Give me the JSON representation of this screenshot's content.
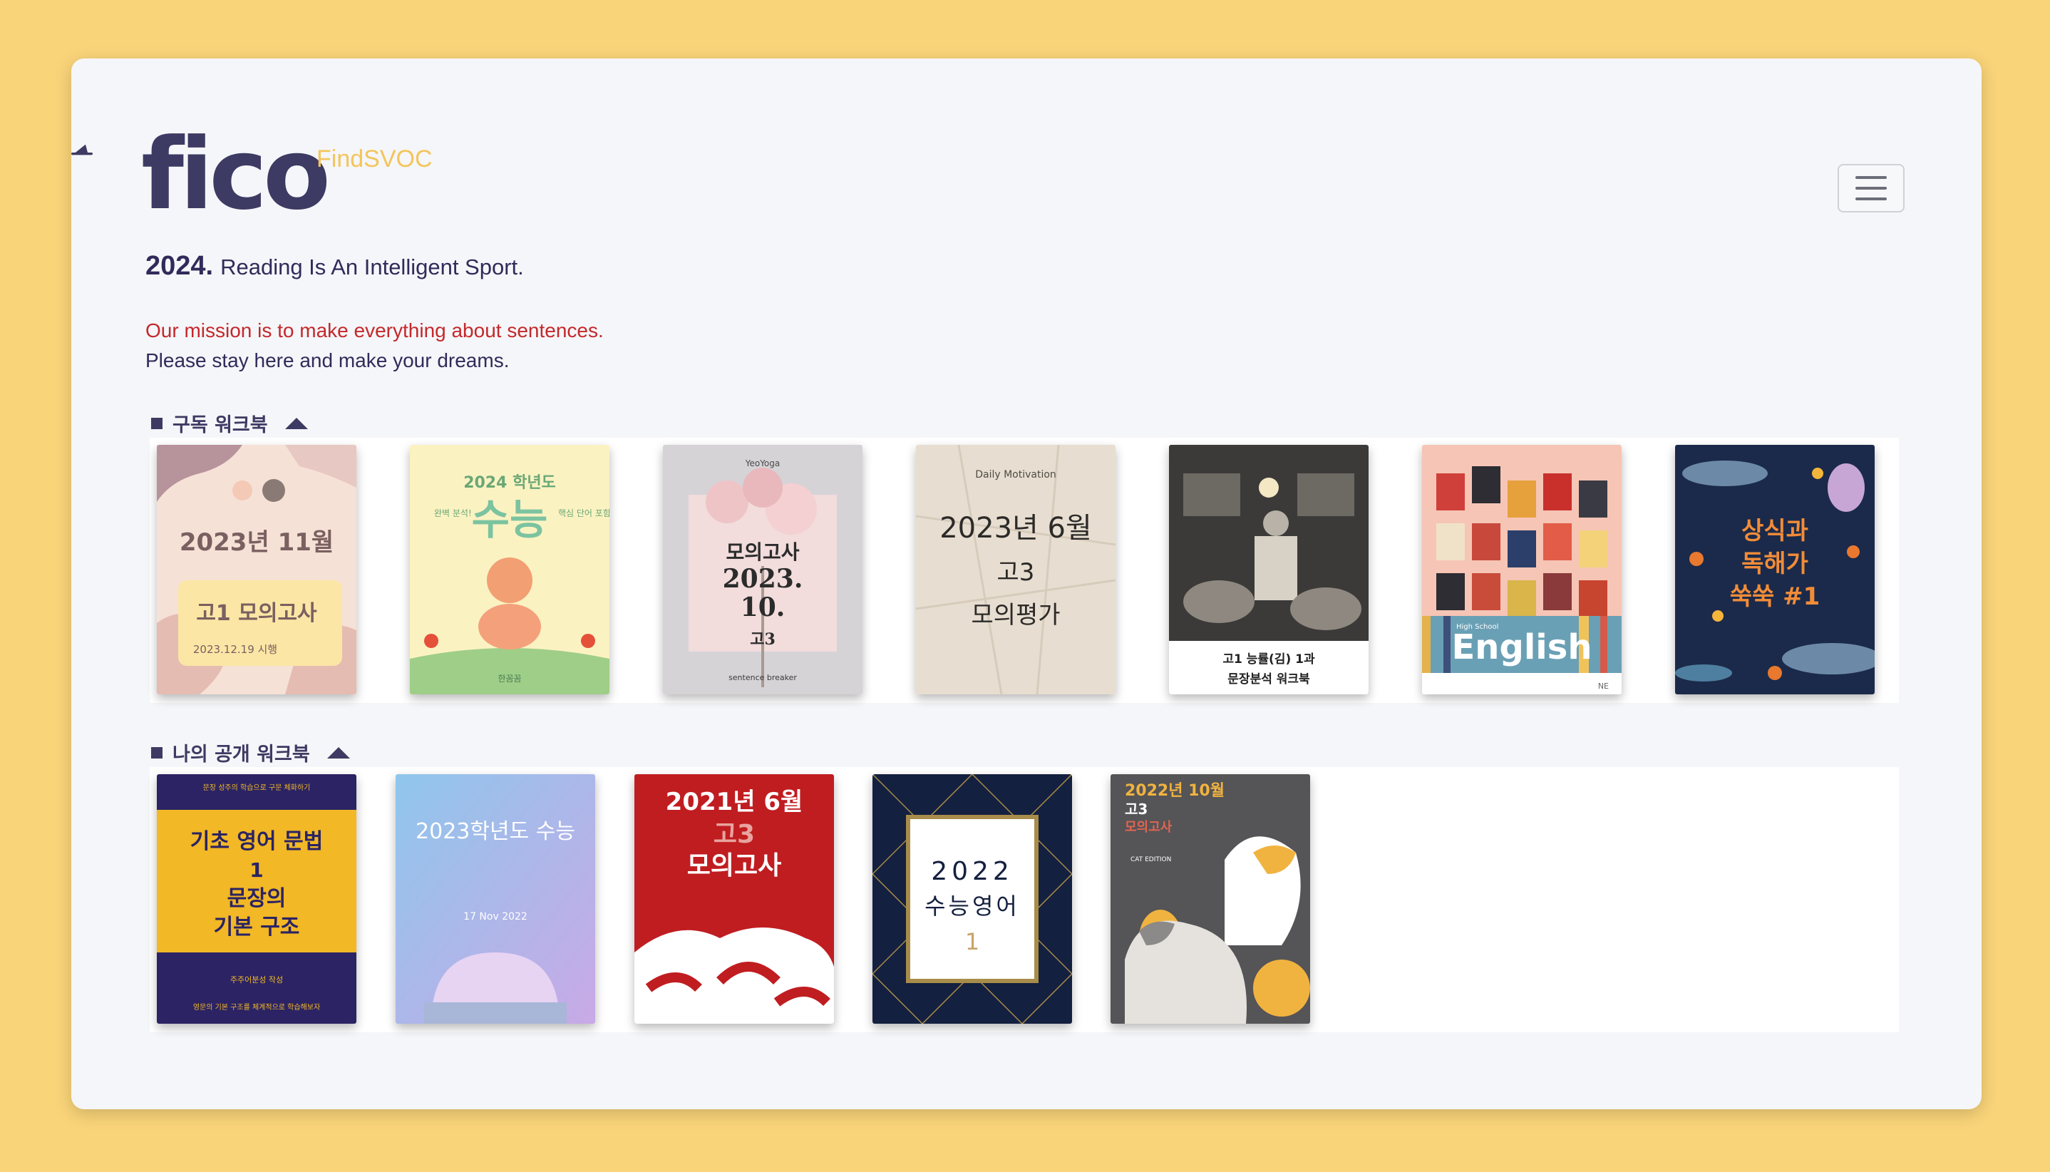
{
  "header": {
    "logo_main": "fico",
    "logo_sub": "FindSVOC",
    "menu_icon": "hamburger-menu-icon"
  },
  "tagline": {
    "year": "2024.",
    "text": "Reading Is An Intelligent Sport."
  },
  "mission": {
    "line1": "Our mission is to make everything about sentences.",
    "line2": "Please stay here and make your dreams."
  },
  "sections": {
    "subscribed": {
      "title": "구독 워크북",
      "books": [
        {
          "title_main": "2023년 11월",
          "title_sub": "고1 모의고사",
          "date": "2023.12.19 시행"
        },
        {
          "title_top": "2024 학년도",
          "title_main": "수능",
          "left_note": "완벽 분석!",
          "right_note": "핵심 단어 포함!",
          "footer": "한꼼꼼"
        },
        {
          "brand": "YeoYoga",
          "title_main": "모의고사",
          "line2": "2023.",
          "line3": "10.",
          "line4": "고3",
          "footer": "sentence breaker"
        },
        {
          "top": "Daily Motivation",
          "line1": "2023년 6월",
          "line2": "고3",
          "line3": "모의평가"
        },
        {
          "line1": "고1 능률(김) 1과",
          "line2": "문장분석 워크북"
        },
        {
          "small": "High School",
          "title_main": "English",
          "corner": "NE"
        },
        {
          "line1": "상식과",
          "line2": "독해가",
          "line3": "쑥쑥 #1"
        }
      ]
    },
    "public": {
      "title": "나의 공개 워크북",
      "books": [
        {
          "top": "문장 성주의 학습으로 구문 체화하기",
          "line1": "기초 영어 문법",
          "line2": "1",
          "line3": "문장의",
          "line4": "기본 구조",
          "author": "주주어분성 작성",
          "bottom": "영문의 기본 구조를 체계적으로 학습해보자"
        },
        {
          "arc": "2023학년도 수능",
          "date": "17 Nov 2022"
        },
        {
          "line1": "2021년 6월",
          "line2": "고3",
          "line3": "모의고사"
        },
        {
          "line1": "2022",
          "line2": "수능영어",
          "line3": "1"
        },
        {
          "line1": "2022년 10월",
          "line2": "고3",
          "line3": "모의고사",
          "edition": "CAT EDITION"
        }
      ]
    }
  },
  "colors": {
    "background": "#f9d479",
    "navy": "#3d3a63",
    "mission_red": "#c4282b",
    "accent_yellow": "#f4c55c"
  }
}
